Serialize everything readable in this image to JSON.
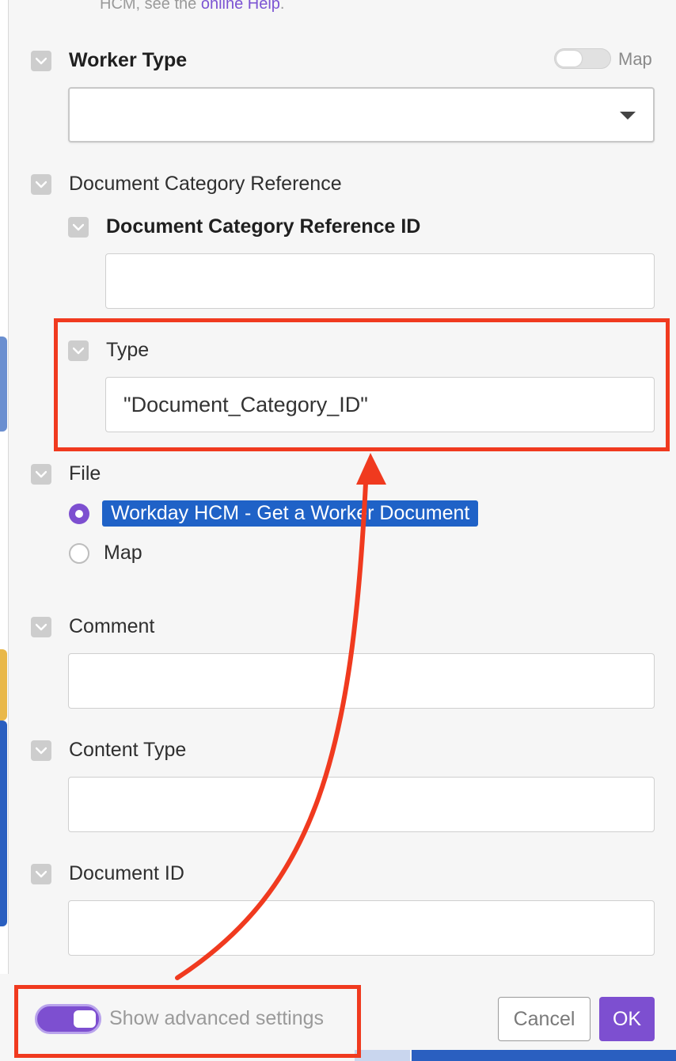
{
  "help": {
    "prefix": "HCM, see the ",
    "link": "online Help",
    "suffix": "."
  },
  "worker_type": {
    "label": "Worker Type",
    "map_label": "Map",
    "value": ""
  },
  "doc_category_ref": {
    "label": "Document Category Reference",
    "id": {
      "label": "Document Category Reference ID",
      "value": ""
    },
    "type": {
      "label": "Type",
      "value": "\"Document_Category_ID\""
    }
  },
  "file": {
    "label": "File",
    "options": [
      {
        "label": "Workday HCM - Get a Worker Document",
        "selected": true
      },
      {
        "label": "Map",
        "selected": false
      }
    ]
  },
  "comment": {
    "label": "Comment",
    "value": ""
  },
  "content_type": {
    "label": "Content Type",
    "value": ""
  },
  "document_id": {
    "label": "Document ID",
    "value": ""
  },
  "footer": {
    "advanced_label": "Show advanced settings",
    "advanced_enabled": true,
    "cancel": "Cancel",
    "ok": "OK"
  },
  "colors": {
    "accent": "#7d4fd0",
    "selection": "#1f62c7",
    "annotation": "#f03a1f"
  }
}
